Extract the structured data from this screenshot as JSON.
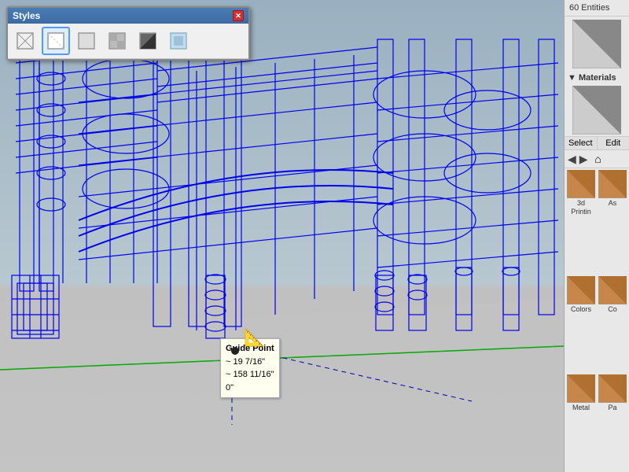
{
  "window": {
    "title": "Styles",
    "close_label": "✕"
  },
  "styles_toolbar": {
    "buttons": [
      {
        "id": "wireframe",
        "label": "Wireframe",
        "active": false
      },
      {
        "id": "hidden-line",
        "label": "Hidden Line",
        "active": true
      },
      {
        "id": "shaded",
        "label": "Shaded",
        "active": false
      },
      {
        "id": "shaded-textured",
        "label": "Shaded with Textures",
        "active": false
      },
      {
        "id": "monochrome",
        "label": "Monochrome",
        "active": false
      },
      {
        "id": "xray",
        "label": "X-Ray",
        "active": false
      }
    ]
  },
  "right_panel": {
    "entities_count": "60 Entities",
    "materials_header": "▼ Materials",
    "select_label": "Select",
    "edit_label": "Edit",
    "material_categories": [
      {
        "id": "3d-printing",
        "label": "3d Printin"
      },
      {
        "id": "colors",
        "label": "Colors"
      },
      {
        "id": "metal",
        "label": "Metal"
      },
      {
        "id": "asphalt",
        "label": "As"
      },
      {
        "id": "concrete",
        "label": "Co"
      },
      {
        "id": "pattern",
        "label": "Pa"
      }
    ]
  },
  "tooltip": {
    "title": "Guide Point",
    "line1": "~ 19 7/16\"",
    "line2": "~ 158 11/16\"",
    "line3": "0\""
  },
  "colors": {
    "wireframe": "#0000ff",
    "background": "#b0b8c0",
    "ground": "#c8c8c8",
    "accent_blue": "#4a7cb5"
  }
}
